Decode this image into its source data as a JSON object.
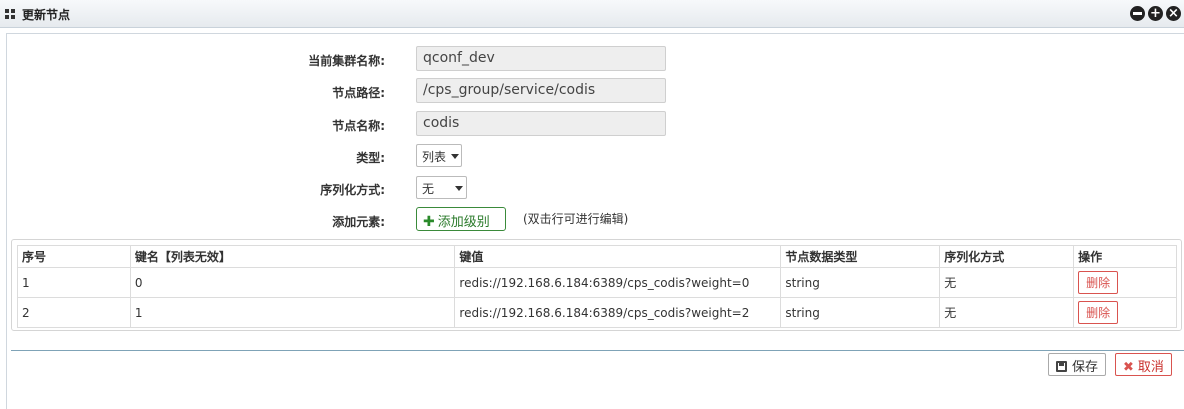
{
  "window": {
    "title": "更新节点"
  },
  "form": {
    "cluster_label": "当前集群名称:",
    "cluster_value": "qconf_dev",
    "path_label": "节点路径:",
    "path_value": "/cps_group/service/codis",
    "name_label": "节点名称:",
    "name_value": "codis",
    "type_label": "类型:",
    "type_value": "列表",
    "serial_label": "序列化方式:",
    "serial_value": "无",
    "add_label": "添加元素:",
    "add_button": "添加级别",
    "hint": "(双击行可进行编辑)"
  },
  "table": {
    "headers": [
      "序号",
      "键名【列表无效】",
      "键值",
      "节点数据类型",
      "序列化方式",
      "操作"
    ],
    "rows": [
      {
        "index": "1",
        "key": "0",
        "value": "redis://192.168.6.184:6389/cps_codis?weight=0",
        "dtype": "string",
        "serial": "无",
        "action": "删除"
      },
      {
        "index": "2",
        "key": "1",
        "value": "redis://192.168.6.184:6389/cps_codis?weight=2",
        "dtype": "string",
        "serial": "无",
        "action": "删除"
      }
    ]
  },
  "footer": {
    "save": "保存",
    "cancel": "取消"
  }
}
